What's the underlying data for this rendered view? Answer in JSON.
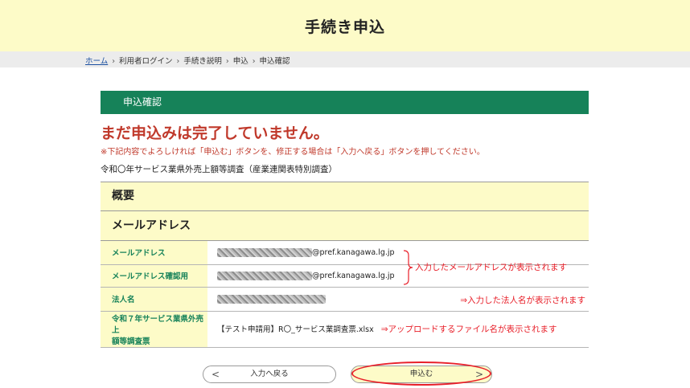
{
  "header": {
    "title": "手続き申込"
  },
  "breadcrumb": {
    "items": [
      "ホーム",
      "利用者ログイン",
      "手続き説明",
      "申込",
      "申込確認"
    ],
    "separator": "›"
  },
  "section": {
    "title": "申込確認"
  },
  "warning": {
    "title": "まだ申込みは完了していません。",
    "note": "※下記内容でよろしければ「申込む」ボタンを、修正する場合は「入力へ戻る」ボタンを押してください。"
  },
  "survey_name": "令和〇年サービス業県外売上額等調査（産業連関表特別調査）",
  "rows": {
    "overview": "概要",
    "email_group": "メールアドレス"
  },
  "fields": {
    "email": {
      "label": "メールアドレス",
      "value_suffix": "@pref.kanagawa.lg.jp"
    },
    "email_confirm": {
      "label": "メールアドレス確認用",
      "value_suffix": "@pref.kanagawa.lg.jp"
    },
    "corp_name": {
      "label": "法人名"
    },
    "survey_file": {
      "label_line1": "令和７年サービス業県外売上",
      "label_line2": "額等調査票",
      "value": "【テスト申請用】R〇_サービス業調査票.xlsx"
    }
  },
  "annotations": {
    "email_note": "入力したメールアドレスが表示されます",
    "corp_note": "⇒入力した法人名が表示されます",
    "file_note": "⇒アップロードするファイル名が表示されます",
    "highlight_color": "#e8202a"
  },
  "buttons": {
    "back": "入力へ戻る",
    "submit": "申込む",
    "back_chevron": "<",
    "submit_chevron": ">"
  },
  "colors": {
    "accent_green": "#168259",
    "header_yellow": "#fdfbc8",
    "warning_red": "#c0392b"
  }
}
